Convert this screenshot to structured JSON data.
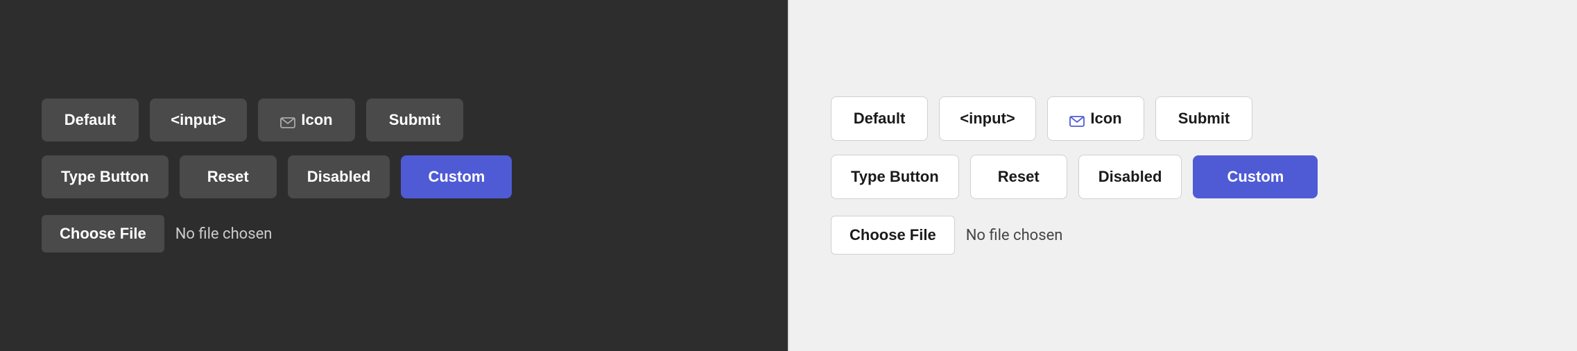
{
  "dark_panel": {
    "background": "#2d2d2d",
    "row1": {
      "buttons": [
        {
          "id": "default",
          "label": "Default",
          "type": "normal"
        },
        {
          "id": "input",
          "label": "<input>",
          "type": "normal"
        },
        {
          "id": "icon",
          "label": "Icon",
          "type": "icon"
        },
        {
          "id": "submit",
          "label": "Submit",
          "type": "normal"
        }
      ]
    },
    "row2": {
      "buttons": [
        {
          "id": "type-button",
          "label": "Type Button",
          "type": "normal"
        },
        {
          "id": "reset",
          "label": "Reset",
          "type": "normal"
        },
        {
          "id": "disabled",
          "label": "Disabled",
          "type": "normal"
        },
        {
          "id": "custom",
          "label": "Custom",
          "type": "custom"
        }
      ]
    },
    "file": {
      "button_label": "Choose File",
      "status": "No file chosen"
    }
  },
  "light_panel": {
    "background": "#f0f0f0",
    "row1": {
      "buttons": [
        {
          "id": "default",
          "label": "Default",
          "type": "normal"
        },
        {
          "id": "input",
          "label": "<input>",
          "type": "normal"
        },
        {
          "id": "icon",
          "label": "Icon",
          "type": "icon"
        },
        {
          "id": "submit",
          "label": "Submit",
          "type": "normal"
        }
      ]
    },
    "row2": {
      "buttons": [
        {
          "id": "type-button",
          "label": "Type Button",
          "type": "normal"
        },
        {
          "id": "reset",
          "label": "Reset",
          "type": "normal"
        },
        {
          "id": "disabled",
          "label": "Disabled",
          "type": "normal"
        },
        {
          "id": "custom",
          "label": "Custom",
          "type": "custom"
        }
      ]
    },
    "file": {
      "button_label": "Choose File",
      "status": "No file chosen"
    }
  }
}
